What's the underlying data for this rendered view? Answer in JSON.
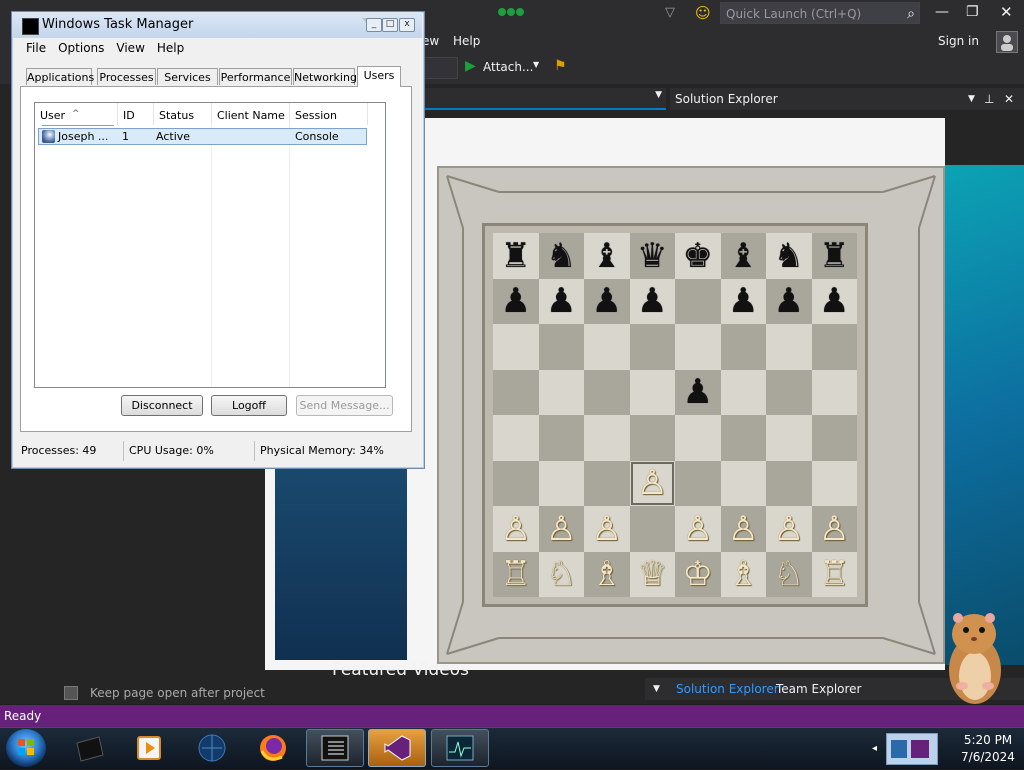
{
  "visual_studio": {
    "quick_launch_placeholder": "Quick Launch (Ctrl+Q)",
    "menu_visible": [
      "ew",
      "Help"
    ],
    "sign_in": "Sign in",
    "attach_label": "Attach...",
    "solution_explorer_title": "Solution Explorer",
    "featured_videos": "Featured Videos",
    "keep_page_open": "Keep page open after project",
    "bottom_tabs": [
      "Solution Explorer",
      "Team Explorer"
    ],
    "status": "Ready",
    "accent_color": "#68217a"
  },
  "chess": {
    "rows": [
      [
        "♜",
        "♞",
        "♝",
        "♛",
        "♚",
        "♝",
        "♞",
        "♜"
      ],
      [
        "♟",
        "♟",
        "♟",
        "♟",
        "",
        "♟",
        "♟",
        "♟"
      ],
      [
        "",
        "",
        "",
        "",
        "",
        "",
        "",
        ""
      ],
      [
        "",
        "",
        "",
        "",
        "♟",
        "",
        "",
        ""
      ],
      [
        "",
        "",
        "",
        "",
        "",
        "",
        "",
        ""
      ],
      [
        "",
        "",
        "",
        "♙",
        "",
        "",
        "",
        ""
      ],
      [
        "♙",
        "♙",
        "♙",
        "",
        "♙",
        "♙",
        "♙",
        "♙"
      ],
      [
        "♖",
        "♘",
        "♗",
        "♕",
        "♔",
        "♗",
        "♘",
        "♖"
      ]
    ],
    "highlighted_square": [
      5,
      3
    ]
  },
  "task_manager": {
    "title": "Windows Task Manager",
    "menu": [
      "File",
      "Options",
      "View",
      "Help"
    ],
    "tabs": [
      "Applications",
      "Processes",
      "Services",
      "Performance",
      "Networking",
      "Users"
    ],
    "active_tab": "Users",
    "columns": [
      "User",
      "ID",
      "Status",
      "Client Name",
      "Session"
    ],
    "rows": [
      {
        "user": "Joseph ...",
        "id": "1",
        "status": "Active",
        "client_name": "",
        "session": "Console"
      }
    ],
    "buttons": {
      "disconnect": "Disconnect",
      "logoff": "Logoff",
      "send_message": "Send Message..."
    },
    "status": {
      "processes": "Processes: 49",
      "cpu": "CPU Usage: 0%",
      "memory": "Physical Memory: 34%"
    }
  },
  "taskbar": {
    "clock_time": "5:20 PM",
    "clock_date": "7/6/2024"
  }
}
